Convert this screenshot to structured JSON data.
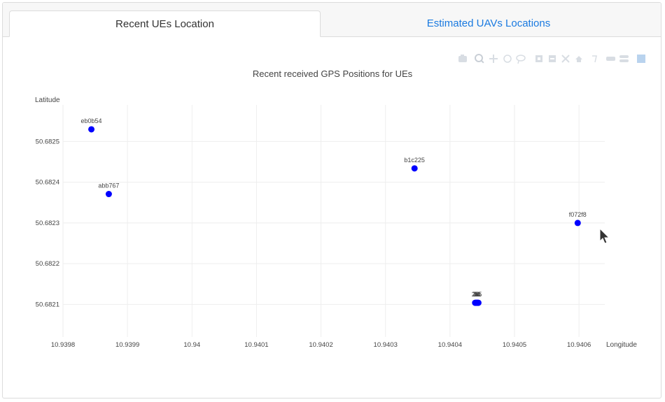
{
  "tabs": [
    {
      "label": "Recent UEs Location",
      "active": true
    },
    {
      "label": "Estimated UAVs Locations",
      "active": false
    }
  ],
  "colors": {
    "accent": "#1a7ae0",
    "marker": "#0000ff",
    "grid": "#eeeeee"
  },
  "modebar_icons": [
    "camera-icon",
    "zoom-icon",
    "pan-icon",
    "box-select-icon",
    "lasso-icon",
    "zoom-in-icon",
    "zoom-out-icon",
    "autoscale-icon",
    "reset-axes-icon",
    "spike-lines-icon",
    "hover-closest-icon",
    "hover-compare-icon",
    "plotly-logo-icon"
  ],
  "chart_data": {
    "type": "scatter",
    "title": "Recent received GPS Positions for UEs",
    "xlabel": "Longitude",
    "ylabel": "Latitude",
    "xlim": [
      10.9398,
      10.94064
    ],
    "ylim": [
      50.68202,
      50.68259
    ],
    "xticks": [
      10.9398,
      10.9399,
      10.94,
      10.9401,
      10.9402,
      10.9403,
      10.9404,
      10.9405,
      10.9406
    ],
    "xtick_labels": [
      "10.9398",
      "10.9399",
      "10.94",
      "10.9401",
      "10.9402",
      "10.9403",
      "10.9404",
      "10.9405",
      "10.9406"
    ],
    "yticks": [
      50.6821,
      50.6822,
      50.6823,
      50.6824,
      50.6825
    ],
    "ytick_labels": [
      "50.6821",
      "50.6822",
      "50.6823",
      "50.6824",
      "50.6825"
    ],
    "grid": true,
    "points": [
      {
        "label": "eb0b54",
        "x": 10.939844,
        "y": 50.68253
      },
      {
        "label": "abb767",
        "x": 10.939871,
        "y": 50.682371
      },
      {
        "label": "b1c225",
        "x": 10.940345,
        "y": 50.682434
      },
      {
        "label": "f072f8",
        "x": 10.940598,
        "y": 50.6823
      },
      {
        "label": "25",
        "x": 10.940439,
        "y": 50.682104
      },
      {
        "label": "7b",
        "x": 10.94044,
        "y": 50.682104
      },
      {
        "label": "34",
        "x": 10.940441,
        "y": 50.682104
      },
      {
        "label": "36",
        "x": 10.940442,
        "y": 50.682104
      },
      {
        "label": "ac",
        "x": 10.940443,
        "y": 50.682104
      },
      {
        "label": "85",
        "x": 10.940444,
        "y": 50.682104
      }
    ]
  }
}
